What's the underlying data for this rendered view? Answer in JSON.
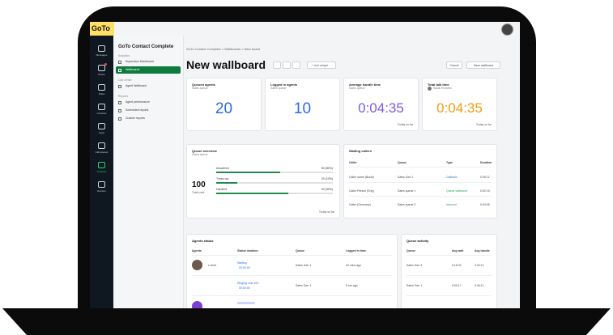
{
  "app": {
    "logo": "GoTo"
  },
  "rail": [
    {
      "label": "Messages"
    },
    {
      "label": "Phone",
      "badge": true
    },
    {
      "label": "Video"
    },
    {
      "label": "Contacts"
    },
    {
      "label": "Apps"
    },
    {
      "label": "Call queues"
    },
    {
      "label": "Analytics",
      "active": true
    },
    {
      "label": "Reports"
    }
  ],
  "sidenav": {
    "title": "GoTo Contact Complete",
    "sections": [
      {
        "label": "Analytics",
        "items": [
          {
            "label": "Supervisor Dashboard",
            "icon": "dashboard-icon"
          },
          {
            "label": "Wallboards",
            "icon": "wallboard-icon",
            "active": true
          }
        ]
      },
      {
        "label": "Call center",
        "items": [
          {
            "label": "Agent Wallboard",
            "icon": "agent-icon"
          }
        ]
      },
      {
        "label": "Reports",
        "items": [
          {
            "label": "Agent performance",
            "icon": "chart-icon"
          },
          {
            "label": "Scheduled reports",
            "icon": "calendar-icon"
          },
          {
            "label": "Custom reports",
            "icon": "report-icon"
          }
        ]
      }
    ]
  },
  "header": {
    "breadcrumb": "GoTo Contact Complete > Wallboards > New board",
    "title": "New wallboard",
    "widget_btn": "+ Add widget",
    "right_btns": [
      "Cancel",
      "Save wallboard"
    ]
  },
  "kpis": [
    {
      "title": "Queued agents",
      "sub": "Sales queue",
      "value": "20",
      "color": "blue"
    },
    {
      "title": "Logged in agents",
      "sub": "Sales queue",
      "value": "10",
      "color": "blue"
    },
    {
      "title": "Average handle time",
      "sub": "Sales queue",
      "value": "0:04:35",
      "color": "purple",
      "link": "Today so far"
    },
    {
      "title": "Total talk time",
      "sub": "Sarah Romero",
      "value": "0:04:35",
      "color": "orange",
      "link": "Today so far"
    }
  ],
  "queue_overview": {
    "title": "Queue overview",
    "sub": "Sales queue",
    "total": "100",
    "total_label": "Total calls",
    "link": "Today so far",
    "bars": [
      {
        "label": "Answered",
        "value": "80 (80%)",
        "pct": 0.55
      },
      {
        "label": "Timed out",
        "value": "20 (10%)",
        "pct": 0.18
      },
      {
        "label": "Handled",
        "value": "90 (90%)",
        "pct": 0.62
      }
    ]
  },
  "waiting": {
    "title": "Waiting callers",
    "columns": [
      "Caller",
      "Queue",
      "Type",
      "Duration"
    ],
    "rows": [
      {
        "caller": "Caller name (Brazil)",
        "queue": "Sales Gen 1",
        "type": "Callback",
        "duration": "0:05:12"
      },
      {
        "caller": "Caller Person (Eng)",
        "queue": "Sales queue 1",
        "type": "Queue outbound",
        "duration": "0:02:15"
      },
      {
        "caller": "Caller (Germany)",
        "queue": "Sales queue 2",
        "type": "Inbound",
        "duration": "0:04:05"
      }
    ]
  },
  "agents": {
    "title": "Agents status",
    "columns": [
      "Agents",
      "Status duration",
      "Queue",
      "Logged in time"
    ],
    "rows": [
      {
        "name": "Lorrell",
        "status": "Waiting",
        "status2": "00:00:00",
        "queue": "Sales Gen 1",
        "logged": "20 mins ago"
      },
      {
        "name": "",
        "status": "Ringing Line 100",
        "status2": "00:00:00",
        "queue": "Sales Gen 1",
        "logged": "5 hrs ago"
      }
    ]
  },
  "queue_activity": {
    "title": "Queue activity",
    "columns": [
      "Queue",
      "Avg wait",
      "Avg handle"
    ],
    "rows": [
      {
        "queue": "Sales Gen 3",
        "wait": "0:15:02",
        "handle": "0:04:11"
      },
      {
        "queue": "Sales Gen 1",
        "wait": "0:00:17",
        "handle": "0:06:11"
      }
    ]
  }
}
